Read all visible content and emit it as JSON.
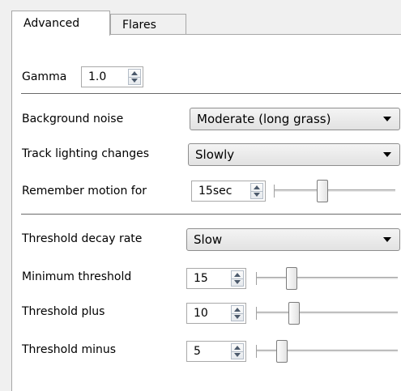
{
  "tabs": [
    {
      "label": "Advanced",
      "active": true
    },
    {
      "label": "Flares",
      "active": false
    }
  ],
  "gamma": {
    "label": "Gamma",
    "value": "1.0"
  },
  "background_noise": {
    "label": "Background noise",
    "selected": "Moderate (long grass)"
  },
  "track_lighting": {
    "label": "Track lighting changes",
    "selected": "Slowly"
  },
  "remember_motion": {
    "label": "Remember motion for",
    "value": "15sec",
    "slider_level": 0.4
  },
  "threshold_decay": {
    "label": "Threshold decay rate",
    "selected": "Slow"
  },
  "min_threshold": {
    "label": "Minimum threshold",
    "value": "15",
    "slider_level": 0.25
  },
  "threshold_plus": {
    "label": "Threshold plus",
    "value": "10",
    "slider_level": 0.27
  },
  "threshold_minus": {
    "label": "Threshold minus",
    "value": "5",
    "slider_level": 0.18
  },
  "colors": {
    "panel": "#ffffff",
    "window": "#f0f0f0",
    "separator": "#6a6a6a",
    "arrow": "#4c5a6c"
  }
}
